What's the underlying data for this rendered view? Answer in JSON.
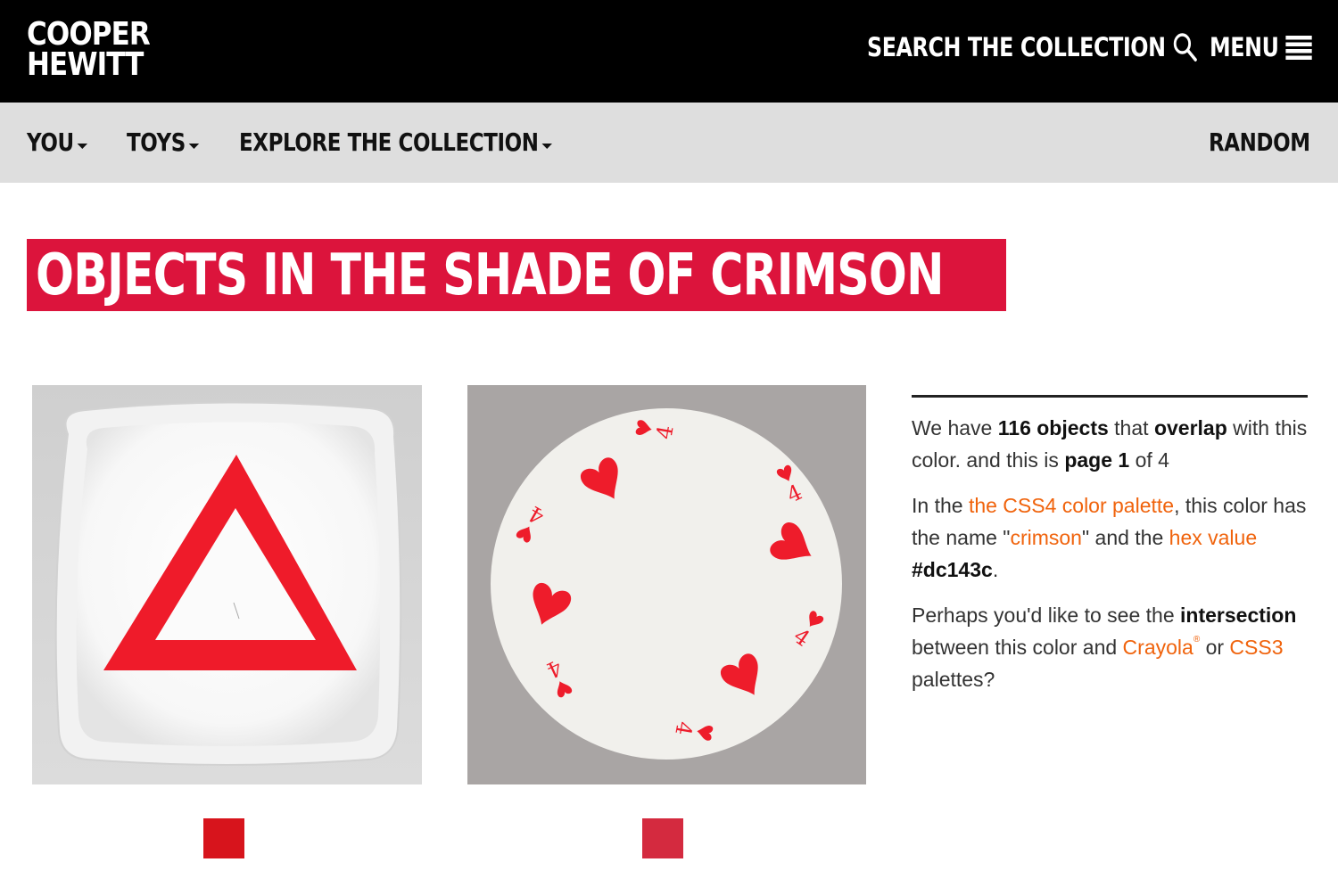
{
  "header": {
    "logo_line1": "COOPER",
    "logo_line2": "HEWITT",
    "search_label": "SEARCH THE COLLECTION",
    "menu_label": "MENU"
  },
  "nav": {
    "items": [
      {
        "label": "YOU"
      },
      {
        "label": "TOYS"
      },
      {
        "label": "EXPLORE THE COLLECTION"
      }
    ],
    "random_label": "RANDOM"
  },
  "page": {
    "title": "OBJECTS IN THE SHADE OF CRIMSON"
  },
  "objects": [
    {
      "icon": "plate-with-red-triangle-image",
      "swatch_color": "#d7141c"
    },
    {
      "icon": "round-playing-card-four-of-hearts-image",
      "swatch_color": "#d42a3f"
    }
  ],
  "info": {
    "p1_pre": "We have ",
    "p1_count": "116 objects",
    "p1_mid": " that ",
    "p1_overlap": "overlap",
    "p1_post": " with this color. and this is ",
    "p1_page": "page 1",
    "p1_end": " of 4",
    "p2_pre": "In the ",
    "p2_link_palette": "the CSS4 color palette",
    "p2_mid": ", this color has the name \"",
    "p2_link_name": "crimson",
    "p2_mid2": "\" and the ",
    "p2_link_hex": "hex value",
    "p2_space": " ",
    "p2_hex": "#dc143c",
    "p2_end": ".",
    "p3_pre": "Perhaps you'd like to see the ",
    "p3_intersection": "intersection",
    "p3_mid": " between this color and ",
    "p3_link_crayola": "Crayola",
    "p3_reg": "®",
    "p3_or": " or ",
    "p3_link_css3": "CSS3",
    "p3_end": " palettes?"
  },
  "colors": {
    "header_bg": "#000000",
    "subnav_bg": "#dedede",
    "crimson": "#dc143c",
    "link": "#f0630c"
  }
}
